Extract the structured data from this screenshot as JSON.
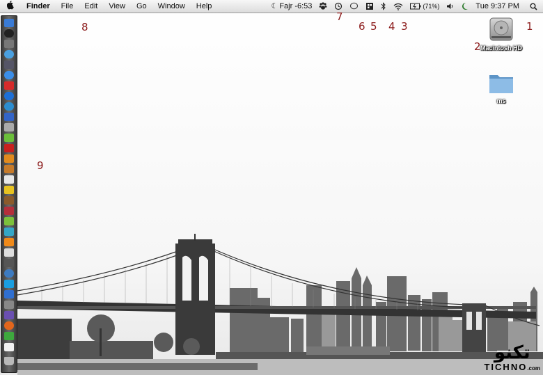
{
  "menubar": {
    "app_name": "Finder",
    "menus": [
      "File",
      "Edit",
      "View",
      "Go",
      "Window",
      "Help"
    ],
    "prayer_time": "Fajr -6:53",
    "battery_percent": "(71%)",
    "clock": "Tue 9:37 PM"
  },
  "desktop_icons": {
    "hd_label": "Macintosh HD",
    "folder_label": "ms"
  },
  "annotations": [
    "1",
    "2",
    "3",
    "4",
    "5",
    "6",
    "7",
    "8",
    "9"
  ],
  "logo": {
    "arabic": "تكنو",
    "latin": "TICHNO",
    "suffix": ".com"
  },
  "colors": {
    "annotation": "#8b1a1a",
    "menubar": "#e6e6e6",
    "dock": "#4a4a4a"
  }
}
